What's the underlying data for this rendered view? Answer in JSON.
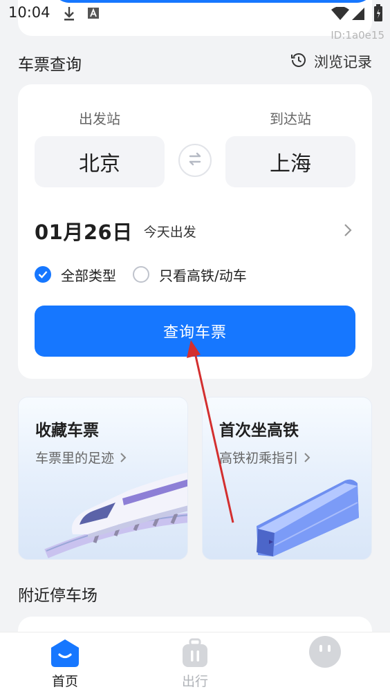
{
  "status_bar": {
    "time": "10:04",
    "icons": [
      "download-icon",
      "font-a-icon",
      "wifi-icon",
      "signal-icon",
      "battery-icon"
    ]
  },
  "watermark": "ID:1a0e15",
  "section": {
    "title": "车票查询",
    "history_label": "浏览记录"
  },
  "query": {
    "from_label": "出发站",
    "to_label": "到达站",
    "from_station": "北京",
    "to_station": "上海",
    "date": "01月26日",
    "date_hint": "今天出发",
    "filters": [
      {
        "label": "全部类型",
        "checked": true
      },
      {
        "label": "只看高铁/动车",
        "checked": false
      }
    ],
    "search_label": "查询车票"
  },
  "features": [
    {
      "title": "收藏车票",
      "subtitle": "车票里的足迹"
    },
    {
      "title": "首次坐高铁",
      "subtitle": "高铁初乘指引"
    }
  ],
  "nearby": {
    "title": "附近停车场"
  },
  "tabs": [
    {
      "label": "首页",
      "active": true
    },
    {
      "label": "出行",
      "active": false
    },
    {
      "label": "",
      "active": false
    }
  ],
  "colors": {
    "accent": "#1677ff",
    "background": "#f2f3f5",
    "annotation": "#d32f2f"
  }
}
